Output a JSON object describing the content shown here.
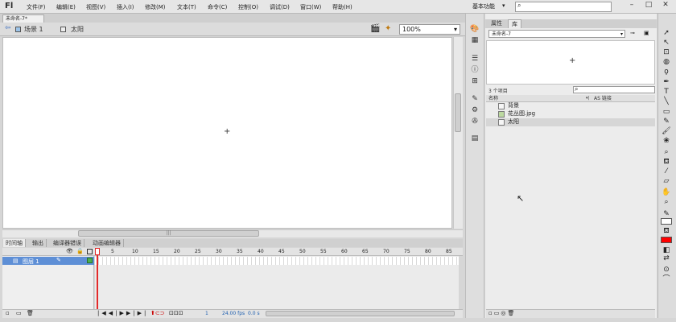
{
  "app": {
    "logo": "Fl"
  },
  "menu": [
    "文件(F)",
    "编辑(E)",
    "视图(V)",
    "插入(I)",
    "修改(M)",
    "文本(T)",
    "命令(C)",
    "控制(O)",
    "调试(D)",
    "窗口(W)",
    "帮助(H)"
  ],
  "workspace": {
    "label": "基本功能",
    "arrow": "▾"
  },
  "window_controls": {
    "minimize": "–",
    "maximize": "□",
    "close": "✕"
  },
  "document": {
    "tab_label": "未命名-7*"
  },
  "editbar": {
    "scene": "场景 1",
    "symbol": "太阳",
    "zoom": "100%"
  },
  "timeline": {
    "tabs": [
      "时间轴",
      "输出",
      "编译器错误",
      "动画编辑器"
    ],
    "frame_numbers": [
      "5",
      "10",
      "15",
      "20",
      "25",
      "30",
      "35",
      "40",
      "45",
      "50",
      "55",
      "60",
      "65",
      "70",
      "75",
      "80",
      "85"
    ],
    "layer": {
      "name": "图层 1"
    },
    "status": {
      "frame": "1",
      "fps": "24.00 fps",
      "time": "0.0 s"
    }
  },
  "library": {
    "tabs": [
      "属性",
      "库"
    ],
    "document_select": "未命名-7",
    "item_count": "3 个项目",
    "columns": {
      "name": "名称",
      "linkage": "AS 链接"
    },
    "items": [
      {
        "name": "背景",
        "icon": "movieclip-icon"
      },
      {
        "name": "花丛图.jpg",
        "icon": "bitmap-icon"
      },
      {
        "name": "太阳",
        "icon": "movieclip-icon"
      }
    ]
  },
  "colors": {
    "fill": "#ff0000",
    "stroke": "#ffffff",
    "layer_highlight": "#5e8fd6",
    "playhead": "#e32a2a"
  }
}
